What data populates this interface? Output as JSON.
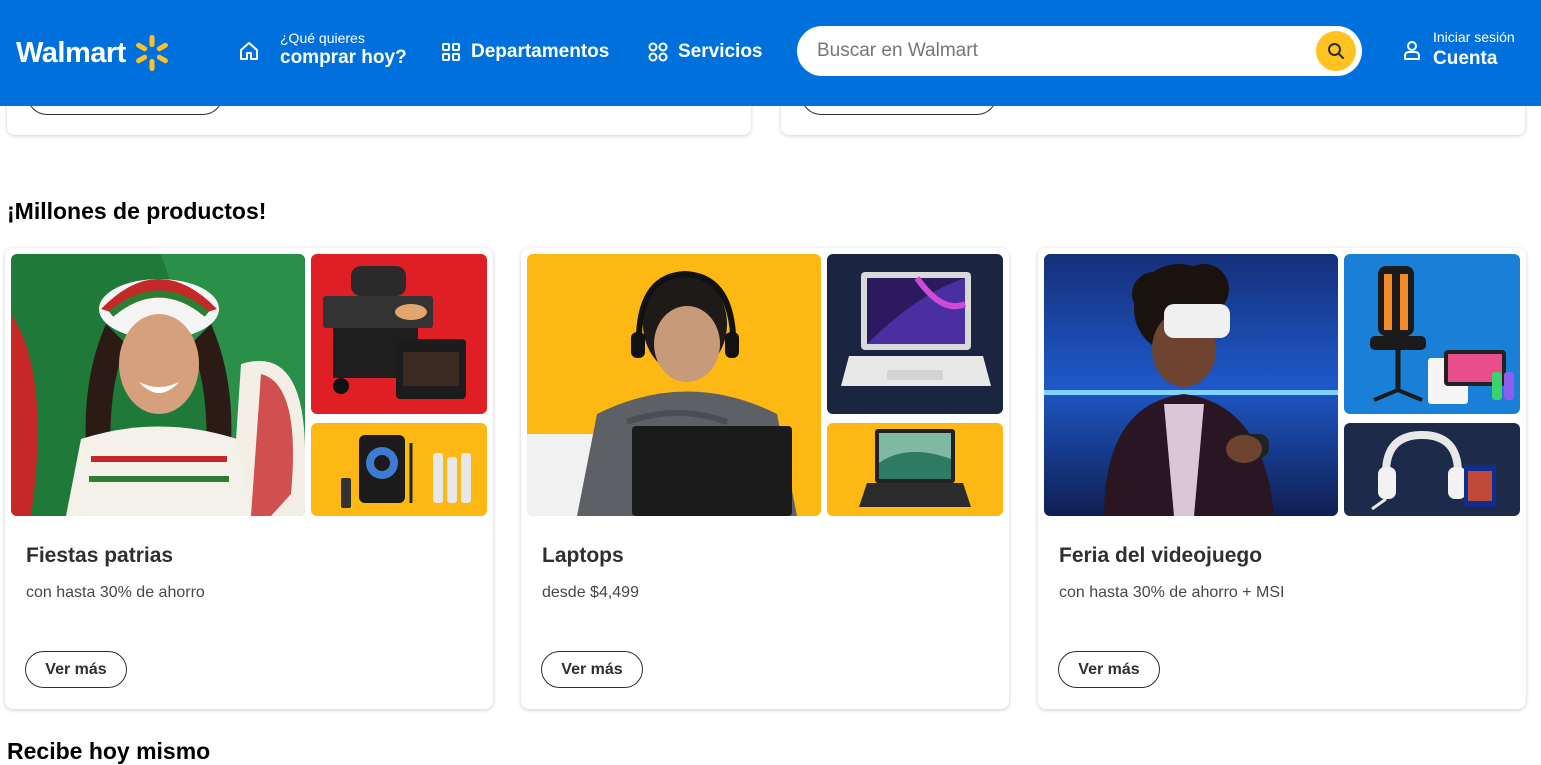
{
  "header": {
    "logo_text": "Walmart",
    "what_small": "¿Qué quieres",
    "what_big": "comprar hoy?",
    "departments_label": "Departamentos",
    "services_label": "Servicios",
    "search_placeholder": "Buscar en Walmart",
    "account_small": "Iniciar sesión",
    "account_big": "Cuenta"
  },
  "colors": {
    "brand_blue": "#0071dc",
    "spark_yellow": "#ffc220"
  },
  "section": {
    "title": "¡Millones de productos!",
    "cards": [
      {
        "title": "Fiestas patrias",
        "subtitle": "con hasta 30% de ahorro",
        "button": "Ver más"
      },
      {
        "title": "Laptops",
        "subtitle": "desde $4,499",
        "button": "Ver más"
      },
      {
        "title": "Feria del videojuego",
        "subtitle": "con hasta 30% de ahorro + MSI",
        "button": "Ver más"
      }
    ]
  },
  "next_section_title": "Recibe hoy mismo"
}
